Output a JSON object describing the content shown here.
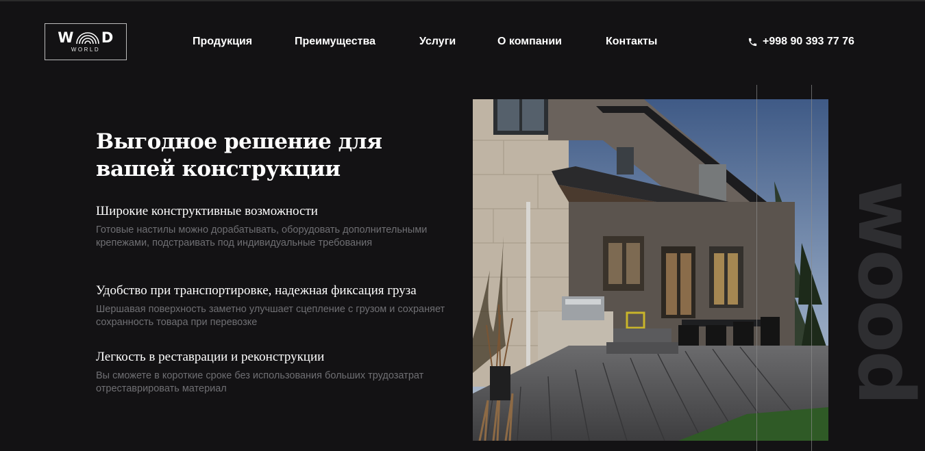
{
  "header": {
    "logo": {
      "main_left": "W",
      "main_right": "D",
      "sub": "WORLD"
    },
    "nav": [
      "Продукция",
      "Преимущества",
      "Услуги",
      "О компании",
      "Контакты"
    ],
    "phone": "+998 90 393 77 76"
  },
  "hero": {
    "title": "Выгодное решение для вашей конструкции",
    "features": [
      {
        "title": "Широкие конструктивные возможности",
        "text": "Готовые настилы можно дорабатывать, оборудовать дополнительными крепежами, подстраивать под индивидуальные требования"
      },
      {
        "title": "Удобство при транспортировке, надежная фиксация груза",
        "text": "Шершавая поверхность заметно улучшает сцепление с грузом и сохраняет сохранность товара при перевозке"
      },
      {
        "title": "Легкость в реставрации и реконструкции",
        "text": "Вы сможете в короткие сроке без использования больших трудозатрат отреставрировать материал"
      }
    ],
    "side_word": "wood"
  },
  "icons": {
    "phone": "phone-icon"
  },
  "colors": {
    "background": "#131214",
    "muted_text": "#6f6f73",
    "side_word": "#2e2e31"
  }
}
